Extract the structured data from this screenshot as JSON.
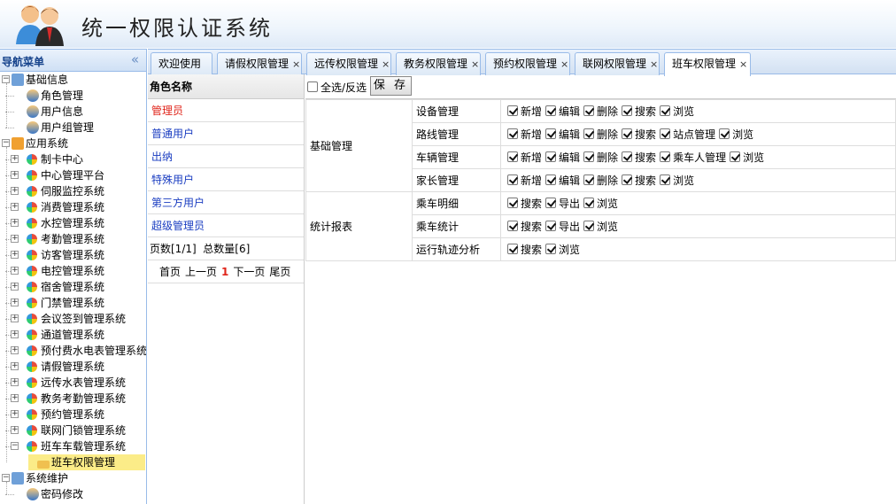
{
  "header": {
    "title": "统一权限认证系统"
  },
  "nav": {
    "title": "导航菜单",
    "collapse": "«",
    "groups": [
      {
        "label": "基础信息",
        "children": [
          "角色管理",
          "用户信息",
          "用户组管理"
        ]
      },
      {
        "label": "应用系统",
        "children": [
          "制卡中心",
          "中心管理平台",
          "伺服监控系统",
          "消费管理系统",
          "水控管理系统",
          "考勤管理系统",
          "访客管理系统",
          "电控管理系统",
          "宿舍管理系统",
          "门禁管理系统",
          "会议签到管理系统",
          "通道管理系统",
          "预付费水电表管理系统",
          "请假管理系统",
          "远传水表管理系统",
          "教务考勤管理系统",
          "预约管理系统",
          "联网门锁管理系统",
          "班车车载管理系统"
        ],
        "sub": "班车权限管理"
      },
      {
        "label": "系统维护",
        "children": [
          "密码修改"
        ]
      }
    ]
  },
  "tabs": [
    {
      "label": "欢迎使用",
      "closable": false
    },
    {
      "label": "请假权限管理",
      "closable": true
    },
    {
      "label": "远传权限管理",
      "closable": true
    },
    {
      "label": "教务权限管理",
      "closable": true
    },
    {
      "label": "预约权限管理",
      "closable": true
    },
    {
      "label": "联网权限管理",
      "closable": true
    },
    {
      "label": "班车权限管理",
      "closable": true,
      "active": true
    }
  ],
  "roles": {
    "header": "角色名称",
    "items": [
      "管理员",
      "普通用户",
      "出纳",
      "特殊用户",
      "第三方用户",
      "超级管理员"
    ],
    "page_info": "页数[1/1]  总数量[6]",
    "pager": {
      "first": "首页",
      "prev": "上一页",
      "current": "1",
      "next": "下一页",
      "last": "尾页"
    }
  },
  "toolbar": {
    "select_all": "全选/反选",
    "save": "保 存"
  },
  "permissions": [
    {
      "group": "基础管理",
      "rows": [
        {
          "name": "设备管理",
          "actions": [
            "新增",
            "编辑",
            "删除",
            "搜索",
            "浏览"
          ]
        },
        {
          "name": "路线管理",
          "actions": [
            "新增",
            "编辑",
            "删除",
            "搜索",
            "站点管理",
            "浏览"
          ]
        },
        {
          "name": "车辆管理",
          "actions": [
            "新增",
            "编辑",
            "删除",
            "搜索",
            "乘车人管理",
            "浏览"
          ]
        },
        {
          "name": "家长管理",
          "actions": [
            "新增",
            "编辑",
            "删除",
            "搜索",
            "浏览"
          ]
        }
      ]
    },
    {
      "group": "统计报表",
      "rows": [
        {
          "name": "乘车明细",
          "actions": [
            "搜索",
            "导出",
            "浏览"
          ]
        },
        {
          "name": "乘车统计",
          "actions": [
            "搜索",
            "导出",
            "浏览"
          ]
        },
        {
          "name": "运行轨迹分析",
          "actions": [
            "搜索",
            "浏览"
          ]
        }
      ]
    }
  ]
}
